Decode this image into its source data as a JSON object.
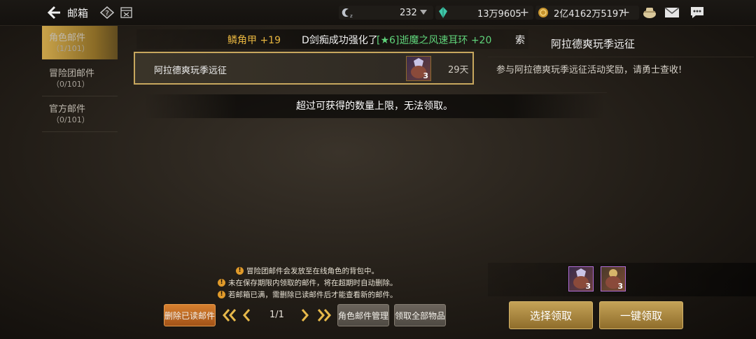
{
  "header": {
    "title": "邮箱",
    "resources": [
      {
        "icon": "fatigue-icon",
        "value": "232"
      },
      {
        "icon": "gem-icon",
        "value": "13万9605"
      },
      {
        "icon": "gold-coin-icon",
        "value": "2亿4162万5197"
      }
    ]
  },
  "sidebar": {
    "items": [
      {
        "label": "角色邮件",
        "count": "（1/101）",
        "active": true
      },
      {
        "label": "冒险团邮件",
        "count": "（0/101）",
        "active": false
      },
      {
        "label": "官方邮件",
        "count": "（0/101）",
        "active": false
      }
    ]
  },
  "ticker": {
    "prefix": "鳞角甲 +19",
    "message": "D剑痴成功强化了",
    "item": "[★6]逝魔之风速耳环 +20",
    "suffix": "索"
  },
  "mail_list": [
    {
      "title": "阿拉德爽玩季远征",
      "days": "29天",
      "item_count": "3"
    }
  ],
  "toast": "超过可获得的数量上限，无法领取。",
  "detail": {
    "title": "阿拉德爽玩季远征",
    "body": "参与阿拉德爽玩季远征活动奖励，请勇士查收!",
    "rewards": [
      {
        "icon": "crystal-pouch-icon",
        "count": "3"
      },
      {
        "icon": "gold-pouch-icon",
        "count": "3"
      }
    ]
  },
  "notices": [
    "冒险团邮件会发放至在线角色的背包中。",
    "未在保存期限内领取的邮件，将在超期时自动删除。",
    "若邮箱已满，需删除已读邮件后才能查看新的邮件。"
  ],
  "footer": {
    "delete_read": "删除已读邮件",
    "page": "1/1",
    "manage": "角色邮件管理",
    "claim_all_items": "领取全部物品",
    "select_claim": "选择领取",
    "one_click_claim": "一键领取"
  },
  "colors": {
    "gold_accent": "#c7a75e",
    "ticker_gold": "#e8b640",
    "ticker_green": "#5fd37a"
  }
}
